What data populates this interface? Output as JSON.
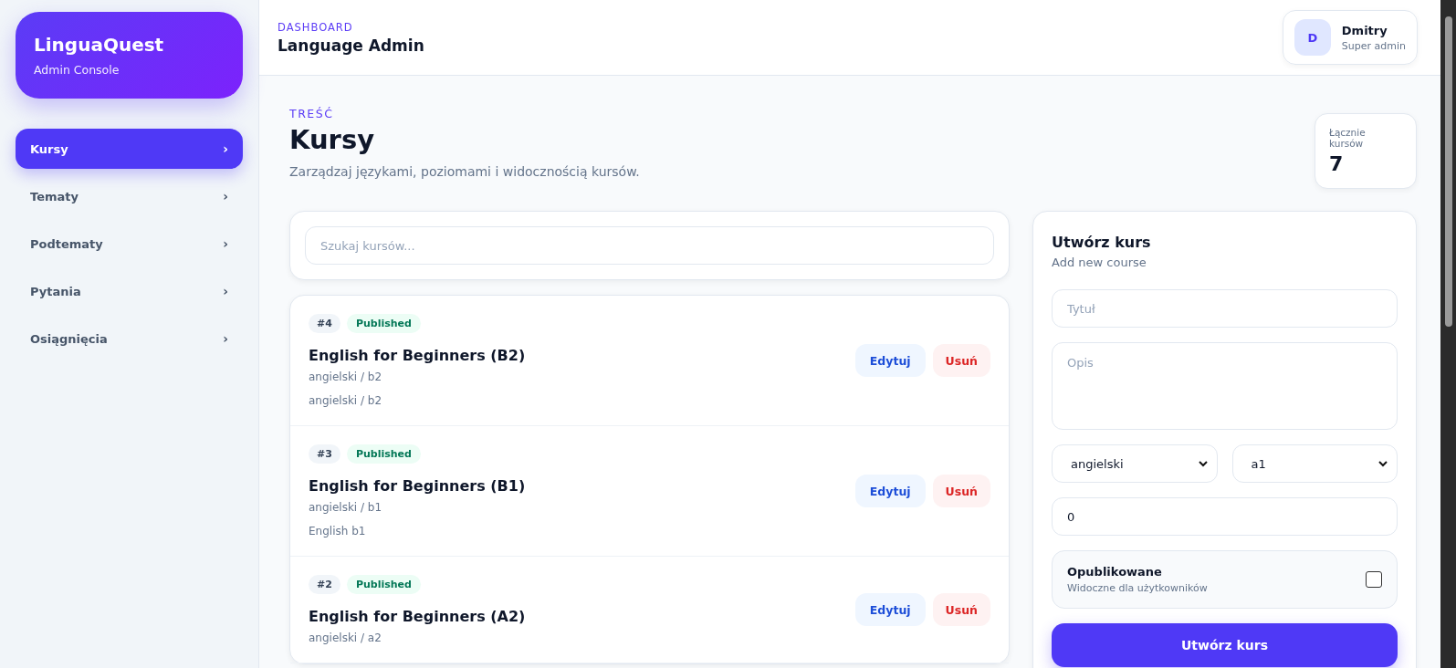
{
  "brand": {
    "title": "LinguaQuest",
    "subtitle": "Admin Console"
  },
  "nav": [
    {
      "label": "Kursy",
      "chevron": "›",
      "selected": true
    },
    {
      "label": "Tematy",
      "chevron": "›",
      "selected": false
    },
    {
      "label": "Podtematy",
      "chevron": "›",
      "selected": false
    },
    {
      "label": "Pytania",
      "chevron": "›",
      "selected": false
    },
    {
      "label": "Osiągnięcia",
      "chevron": "›",
      "selected": false
    }
  ],
  "header": {
    "eyebrow": "DASHBOARD",
    "title": "Language Admin",
    "user": {
      "initial": "D",
      "name": "Dmitry",
      "role": "Super admin"
    }
  },
  "page": {
    "eyebrow": "TREŚĆ",
    "title": "Kursy",
    "subtitle": "Zarządzaj językami, poziomami i widocznością kursów.",
    "stat": {
      "label": "Łącznie kursów",
      "value": "7"
    }
  },
  "search": {
    "placeholder": "Szukaj kursów..."
  },
  "courses": [
    {
      "id": "#4",
      "status": "Published",
      "published": true,
      "title": "English for Beginners (B2)",
      "path": "angielski / b2",
      "description": "angielski / b2",
      "edit": "Edytuj",
      "delete": "Usuń"
    },
    {
      "id": "#3",
      "status": "Published",
      "published": true,
      "title": "English for Beginners (B1)",
      "path": "angielski / b1",
      "description": "English b1",
      "edit": "Edytuj",
      "delete": "Usuń"
    },
    {
      "id": "#2",
      "status": "Published",
      "published": true,
      "title": "English for Beginners (A2)",
      "path": "angielski / a2",
      "edit": "Edytuj",
      "delete": "Usuń"
    }
  ],
  "form": {
    "title": "Utwórz kurs",
    "subtitle": "Add new course",
    "title_placeholder": "Tytuł",
    "description_placeholder": "Opis",
    "language": "angielski",
    "level": "a1",
    "order": "0",
    "published_label": "Opublikowane",
    "published_hint": "Widoczne dla użytkowników",
    "published": false,
    "submit": "Utwórz kurs"
  }
}
